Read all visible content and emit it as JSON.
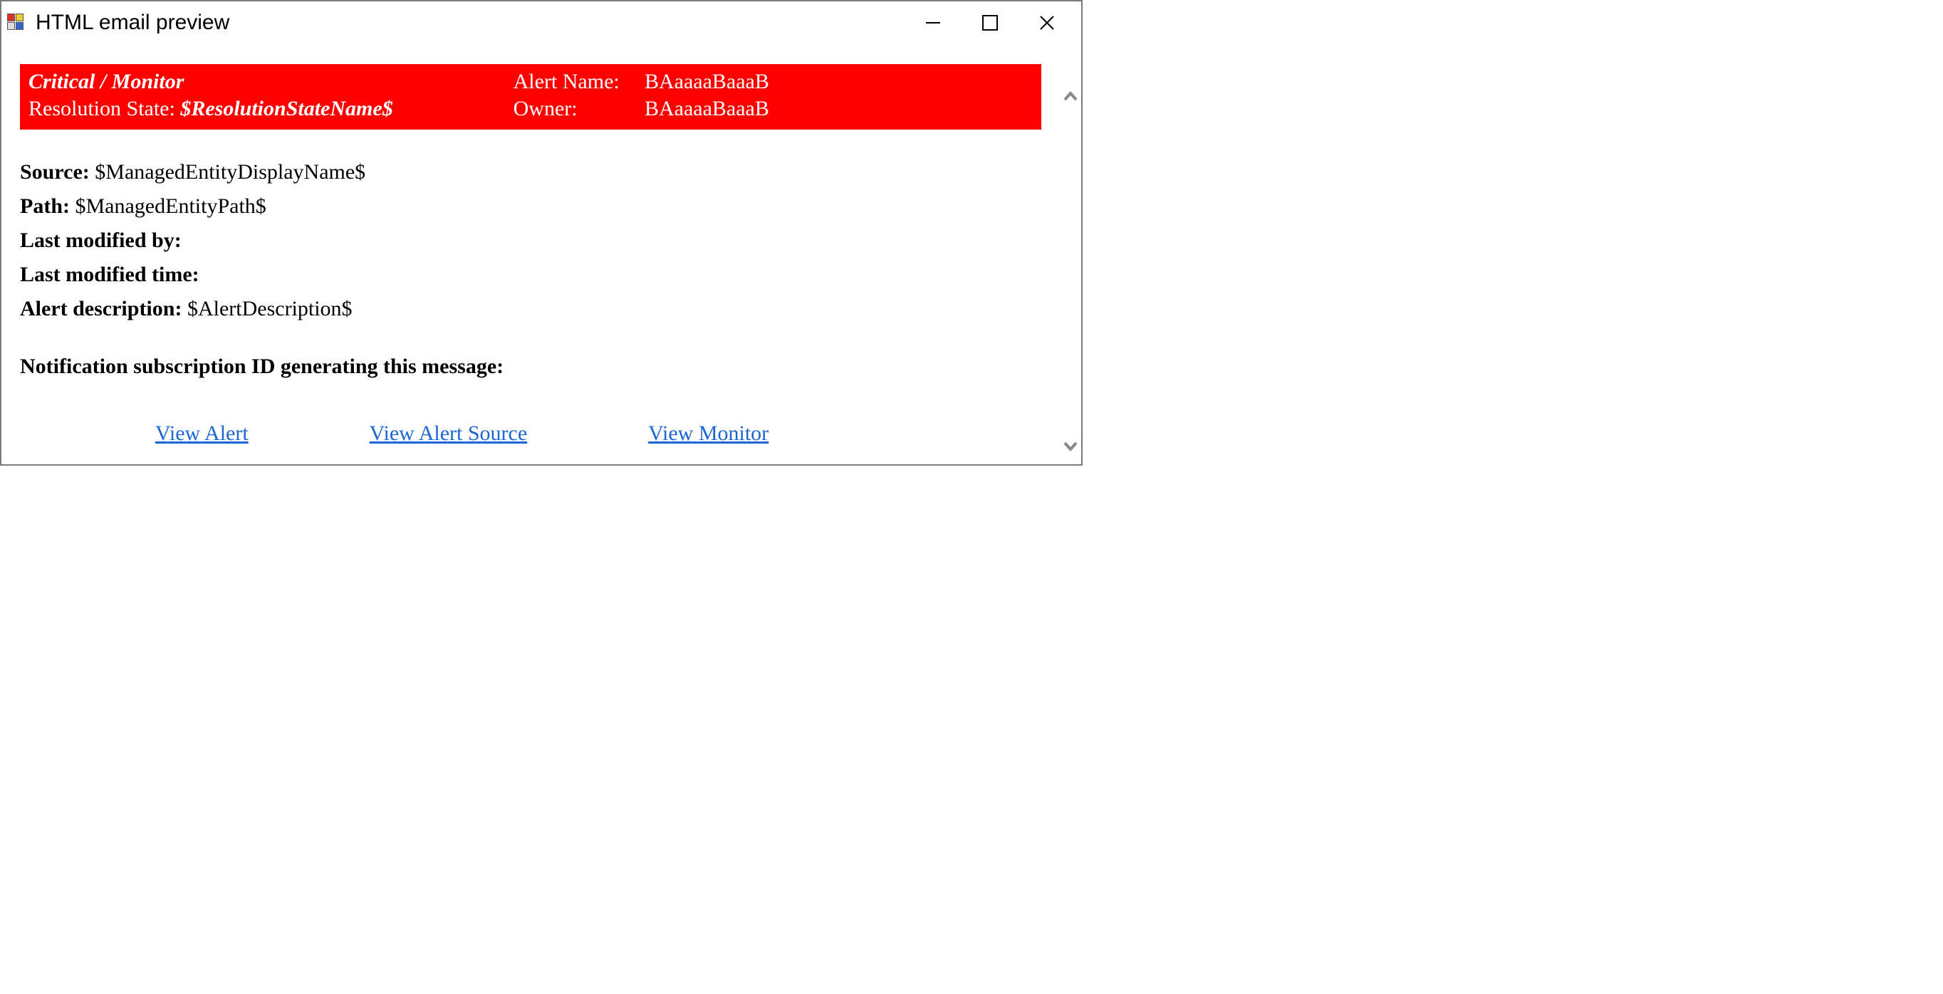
{
  "window": {
    "title": "HTML email preview"
  },
  "banner": {
    "severity": "Critical / Monitor",
    "alert_name_label": "Alert Name:",
    "alert_name_value": "BAaaaaBaaaB",
    "resolution_label": "Resolution State:",
    "resolution_value": "$ResolutionStateName$",
    "owner_label": "Owner:",
    "owner_value": "BAaaaaBaaaB"
  },
  "details": {
    "source_label": "Source:",
    "source_value": "$ManagedEntityDisplayName$",
    "path_label": "Path:",
    "path_value": "$ManagedEntityPath$",
    "last_modified_by_label": "Last modified by:",
    "last_modified_by_value": "",
    "last_modified_time_label": "Last modified time:",
    "last_modified_time_value": "",
    "alert_description_label": "Alert description:",
    "alert_description_value": "$AlertDescription$"
  },
  "subscription": {
    "label": "Notification subscription ID generating this message:"
  },
  "links": {
    "view_alert": "View Alert",
    "view_alert_source": "View Alert Source",
    "view_monitor": "View Monitor"
  }
}
